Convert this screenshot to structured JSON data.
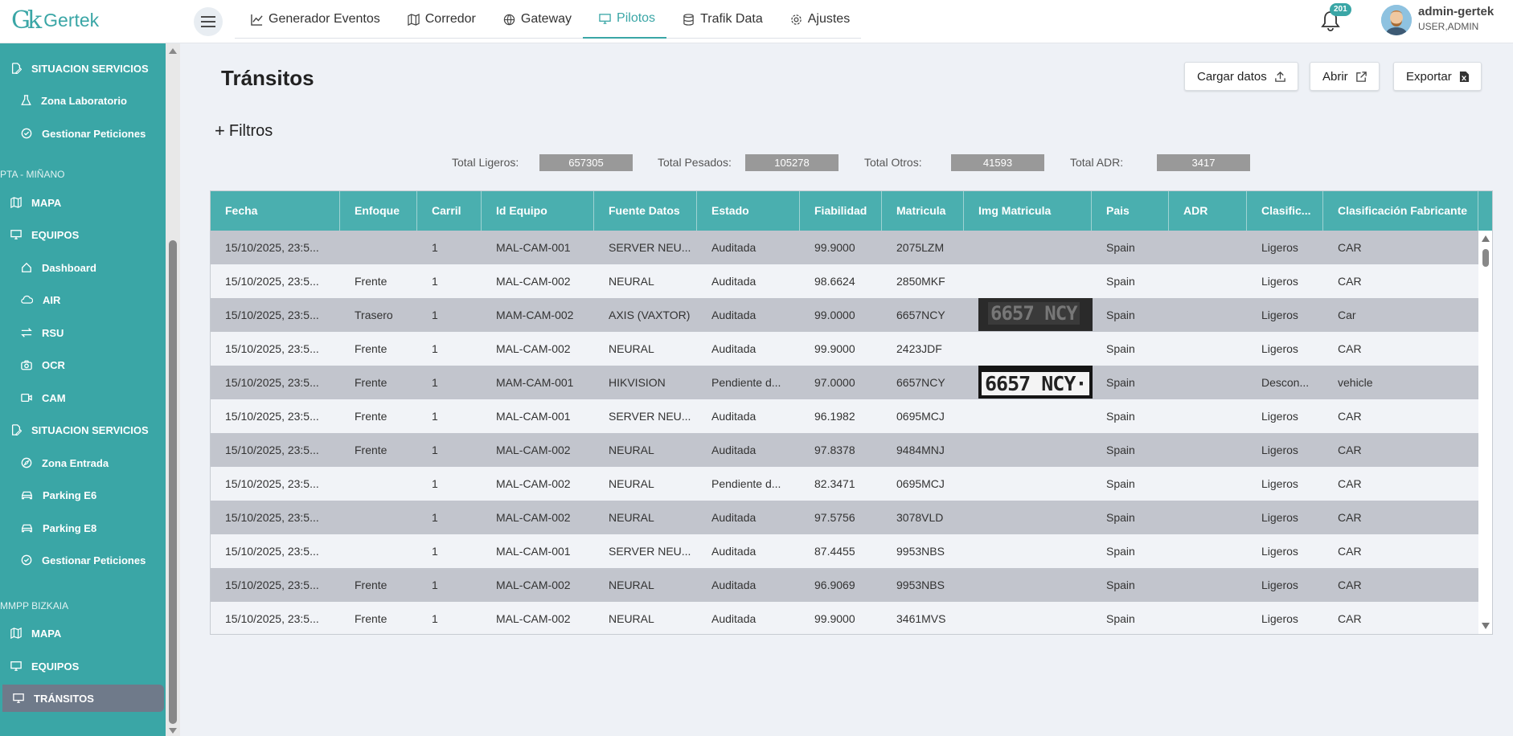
{
  "app": {
    "logo_mark": "Gk",
    "logo_text": "Gertek",
    "brand_color": "#3aa6a6"
  },
  "nav": [
    {
      "label": "Generador Eventos",
      "icon": "chart-line-icon"
    },
    {
      "label": "Corredor",
      "icon": "map-icon"
    },
    {
      "label": "Gateway",
      "icon": "globe-icon"
    },
    {
      "label": "Pilotos",
      "icon": "monitor-icon",
      "active": true
    },
    {
      "label": "Trafik Data",
      "icon": "database-icon"
    },
    {
      "label": "Ajustes",
      "icon": "gear-icon"
    }
  ],
  "notifications": {
    "count": "201"
  },
  "user": {
    "name": "admin-gertek",
    "role": "USER,ADMIN"
  },
  "sidebar": {
    "items": [
      {
        "label": "SITUACION SERVICIOS",
        "icon": "edit-doc-icon"
      },
      {
        "label": "Zona Laboratorio",
        "icon": "flask-icon"
      },
      {
        "label": "Gestionar Peticiones",
        "icon": "check-circle-icon"
      },
      {
        "section": "PTA - MIÑANO"
      },
      {
        "label": "MAPA",
        "icon": "map-icon"
      },
      {
        "label": "EQUIPOS",
        "icon": "monitor-icon"
      },
      {
        "label": "Dashboard",
        "icon": "home-icon"
      },
      {
        "label": "AIR",
        "icon": "cloud-icon"
      },
      {
        "label": "RSU",
        "icon": "arrows-icon"
      },
      {
        "label": "OCR",
        "icon": "camera-icon"
      },
      {
        "label": "CAM",
        "icon": "video-icon"
      },
      {
        "label": "SITUACION SERVICIOS",
        "icon": "edit-doc-icon"
      },
      {
        "label": "Zona Entrada",
        "icon": "compass-icon"
      },
      {
        "label": "Parking E6",
        "icon": "car-icon"
      },
      {
        "label": "Parking E8",
        "icon": "car-icon"
      },
      {
        "label": "Gestionar Peticiones",
        "icon": "check-circle-icon"
      },
      {
        "section": "MMPP BIZKAIA"
      },
      {
        "label": "MAPA",
        "icon": "map-icon"
      },
      {
        "label": "EQUIPOS",
        "icon": "monitor-icon"
      },
      {
        "label": "TRÁNSITOS",
        "icon": "monitor-icon",
        "active": true
      }
    ]
  },
  "page": {
    "title": "Tránsitos"
  },
  "toolbar": {
    "load_label": "Cargar datos",
    "open_label": "Abrir",
    "export_label": "Exportar"
  },
  "filters": {
    "label": "Filtros",
    "plus": "+"
  },
  "totals": {
    "ligeros_label": "Total Ligeros:",
    "ligeros": "657305",
    "pesados_label": "Total Pesados:",
    "pesados": "105278",
    "otros_label": "Total Otros:",
    "otros": "41593",
    "adr_label": "Total ADR:",
    "adr": "3417"
  },
  "table": {
    "columns": [
      "Fecha",
      "Enfoque",
      "Carril",
      "Id Equipo",
      "Fuente Datos",
      "Estado",
      "Fiabilidad",
      "Matricula",
      "Img Matricula",
      "Pais",
      "ADR",
      "Clasific...",
      "Clasificación Fabricante"
    ],
    "rows": [
      [
        "15/10/2025, 23:5...",
        "",
        "1",
        "MAL-CAM-001",
        "SERVER NEU...",
        "Auditada",
        "99.9000",
        "2075LZM",
        "",
        "Spain",
        "",
        "Ligeros",
        "CAR"
      ],
      [
        "15/10/2025, 23:5...",
        "Frente",
        "1",
        "MAL-CAM-002",
        "NEURAL",
        "Auditada",
        "98.6624",
        "2850MKF",
        "",
        "Spain",
        "",
        "Ligeros",
        "CAR"
      ],
      [
        "15/10/2025, 23:5...",
        "Trasero",
        "1",
        "MAM-CAM-002",
        "AXIS (VAXTOR)",
        "Auditada",
        "99.0000",
        "6657NCY",
        "6657 NCY",
        "Spain",
        "",
        "Ligeros",
        "Car"
      ],
      [
        "15/10/2025, 23:5...",
        "Frente",
        "1",
        "MAL-CAM-002",
        "NEURAL",
        "Auditada",
        "99.9000",
        "2423JDF",
        "",
        "Spain",
        "",
        "Ligeros",
        "CAR"
      ],
      [
        "15/10/2025, 23:5...",
        "Frente",
        "1",
        "MAM-CAM-001",
        "HIKVISION",
        "Pendiente d...",
        "97.0000",
        "6657NCY",
        "6657 NCY·",
        "Spain",
        "",
        "Descon...",
        "vehicle"
      ],
      [
        "15/10/2025, 23:5...",
        "Frente",
        "1",
        "MAL-CAM-001",
        "SERVER NEU...",
        "Auditada",
        "96.1982",
        "0695MCJ",
        "",
        "Spain",
        "",
        "Ligeros",
        "CAR"
      ],
      [
        "15/10/2025, 23:5...",
        "Frente",
        "1",
        "MAL-CAM-002",
        "NEURAL",
        "Auditada",
        "97.8378",
        "9484MNJ",
        "",
        "Spain",
        "",
        "Ligeros",
        "CAR"
      ],
      [
        "15/10/2025, 23:5...",
        "",
        "1",
        "MAL-CAM-002",
        "NEURAL",
        "Pendiente d...",
        "82.3471",
        "0695MCJ",
        "",
        "Spain",
        "",
        "Ligeros",
        "CAR"
      ],
      [
        "15/10/2025, 23:5...",
        "",
        "1",
        "MAL-CAM-002",
        "NEURAL",
        "Auditada",
        "97.5756",
        "3078VLD",
        "",
        "Spain",
        "",
        "Ligeros",
        "CAR"
      ],
      [
        "15/10/2025, 23:5...",
        "",
        "1",
        "MAL-CAM-001",
        "SERVER NEU...",
        "Auditada",
        "87.4455",
        "9953NBS",
        "",
        "Spain",
        "",
        "Ligeros",
        "CAR"
      ],
      [
        "15/10/2025, 23:5...",
        "Frente",
        "1",
        "MAL-CAM-002",
        "NEURAL",
        "Auditada",
        "96.9069",
        "9953NBS",
        "",
        "Spain",
        "",
        "Ligeros",
        "CAR"
      ],
      [
        "15/10/2025, 23:5...",
        "Frente",
        "1",
        "MAL-CAM-002",
        "NEURAL",
        "Auditada",
        "99.9000",
        "3461MVS",
        "",
        "Spain",
        "",
        "Ligeros",
        "CAR"
      ]
    ]
  }
}
